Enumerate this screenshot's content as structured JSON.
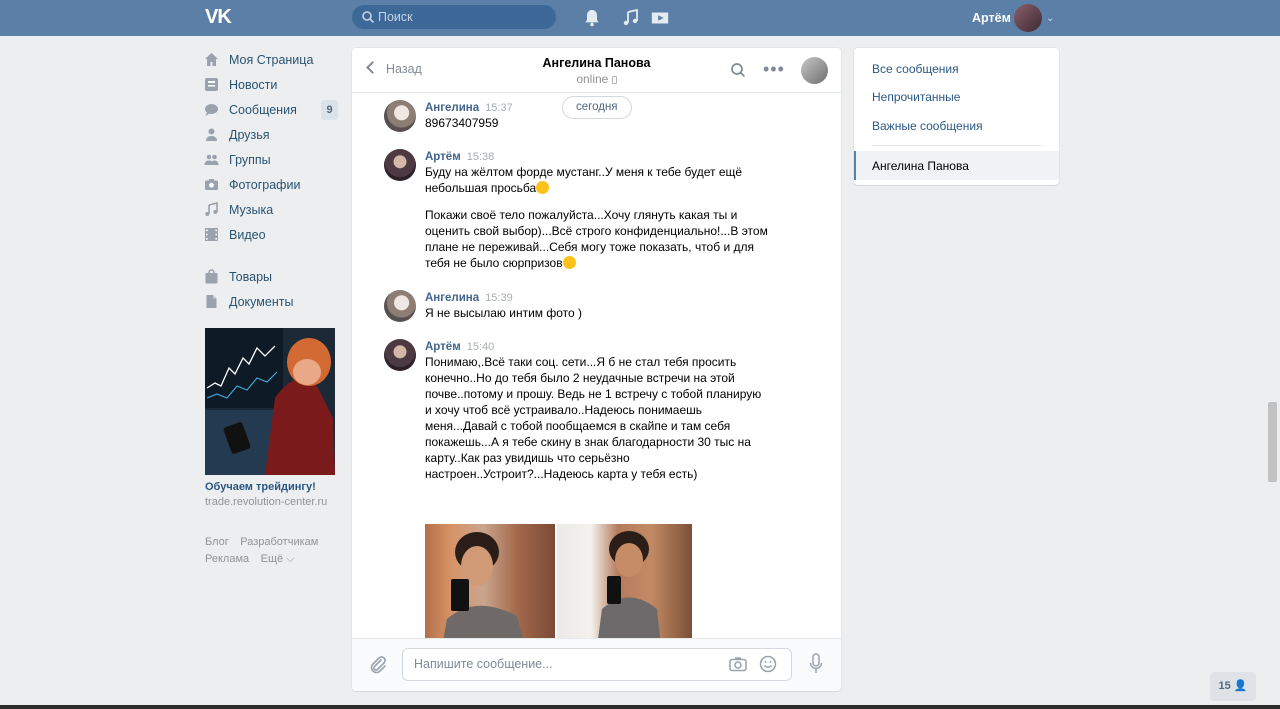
{
  "topbar": {
    "logo": "VK",
    "search_placeholder": "Поиск",
    "user_name": "Артём",
    "icons": [
      "bell-icon",
      "music-note-icon",
      "play-icon"
    ]
  },
  "sidebar": {
    "items": [
      {
        "label": "Моя Страница",
        "icon": "home-icon"
      },
      {
        "label": "Новости",
        "icon": "news-icon"
      },
      {
        "label": "Сообщения",
        "icon": "chat-icon",
        "count": "9"
      },
      {
        "label": "Друзья",
        "icon": "person-icon"
      },
      {
        "label": "Группы",
        "icon": "group-icon"
      },
      {
        "label": "Фотографии",
        "icon": "camera-icon"
      },
      {
        "label": "Музыка",
        "icon": "music-icon"
      },
      {
        "label": "Видео",
        "icon": "film-icon"
      },
      {
        "label": "Товары",
        "icon": "bag-icon"
      },
      {
        "label": "Документы",
        "icon": "document-icon"
      }
    ],
    "ad": {
      "title": "Обучаем трейдингу!",
      "url": "trade.revolution-center.ru"
    },
    "footer_links": [
      "Блог",
      "Разработчикам",
      "Реклама",
      "Ещё ⌵"
    ]
  },
  "chat": {
    "back_label": "Назад",
    "peer_name": "Ангелина Панова",
    "peer_status": "online",
    "date_label": "сегодня",
    "messages": [
      {
        "author": "Ангелина",
        "time": "15:37",
        "lines": [
          "89673407959"
        ]
      },
      {
        "author": "Артём",
        "time": "15:38",
        "p1": "Буду на жёлтом форде мустанг..У меня к тебе будет ещё небольшая просьба",
        "p2": "Покажи своё тело пожалуйста...Хочу глянуть какая ты и оценить свой выбор)...Всё строго конфиденциально!...В этом плане не переживай...Себя могу тоже показать, чтоб и для тебя не было сюрпризов"
      },
      {
        "author": "Ангелина",
        "time": "15:39",
        "lines": [
          "Я не высылаю интим фото )"
        ]
      },
      {
        "author": "Артём",
        "time": "15:40",
        "text": "Понимаю,.Всё таки соц. сети...Я б не стал тебя просить конечно..Но до тебя было 2 неудачные встречи на этой почве..потому и прошу. Ведь не 1 встречу с тобой планирую и хочу чтоб всё устраивало..Надеюсь понимаешь меня...Давай с тобой пообщаемся в скайпе и там себя покажешь...А я тебе скину в знак благодарности 30 тыс на карту..Как раз увидишь что серьёзно настроен..Устроит?...Надеюсь карта у тебя есть)"
      }
    ],
    "composer_placeholder": "Напишите сообщение..."
  },
  "right_panel": {
    "items": [
      "Все сообщения",
      "Непрочитанные",
      "Важные сообщения"
    ],
    "active": "Ангелина Панова"
  },
  "online_count": "15"
}
